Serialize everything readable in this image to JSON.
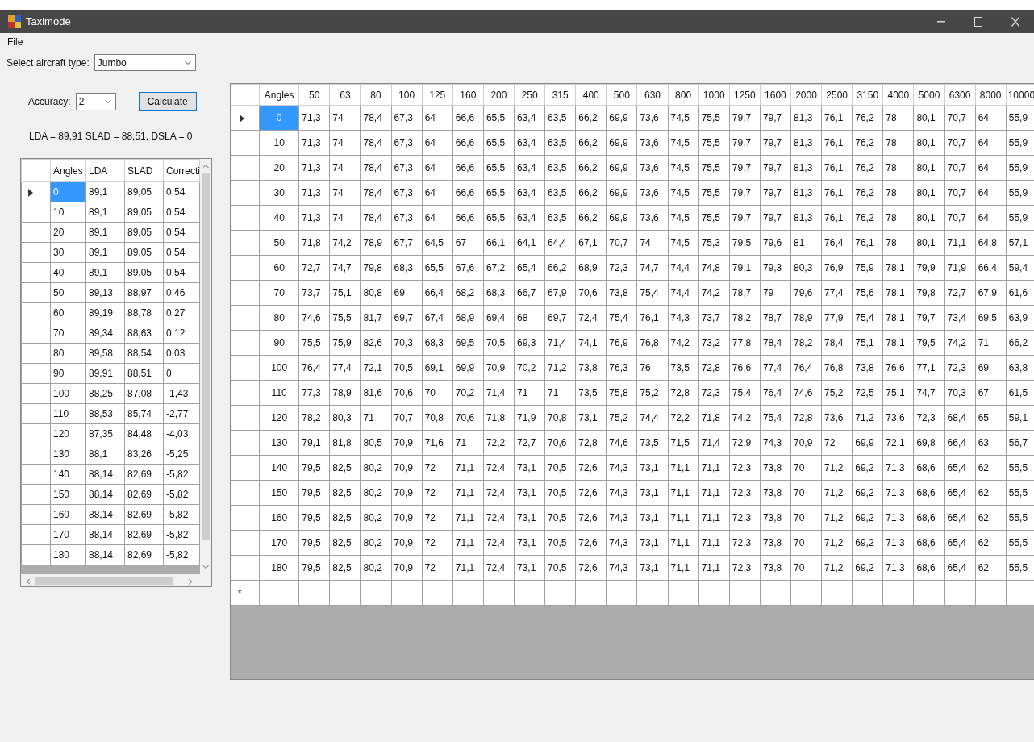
{
  "window": {
    "title": "Taximode"
  },
  "menu": [
    "File"
  ],
  "aircraft": {
    "label": "Select aircraft type:",
    "value": "Jumbo"
  },
  "accuracy": {
    "label": "Accuracy:",
    "value": "2"
  },
  "calculate_button": "Calculate",
  "result": "LDA = 89,91 SLAD = 88,51, DSLA = 0",
  "summary_table": {
    "columns": [
      "Angles",
      "LDA",
      "SLAD",
      "Correcti"
    ],
    "rows": [
      {
        "selected": true,
        "cells": [
          "0",
          "89,1",
          "89,05",
          "0,54"
        ]
      },
      {
        "selected": false,
        "cells": [
          "10",
          "89,1",
          "89,05",
          "0,54"
        ]
      },
      {
        "selected": false,
        "cells": [
          "20",
          "89,1",
          "89,05",
          "0,54"
        ]
      },
      {
        "selected": false,
        "cells": [
          "30",
          "89,1",
          "89,05",
          "0,54"
        ]
      },
      {
        "selected": false,
        "cells": [
          "40",
          "89,1",
          "89,05",
          "0,54"
        ]
      },
      {
        "selected": false,
        "cells": [
          "50",
          "89,13",
          "88,97",
          "0,46"
        ]
      },
      {
        "selected": false,
        "cells": [
          "60",
          "89,19",
          "88,78",
          "0,27"
        ]
      },
      {
        "selected": false,
        "cells": [
          "70",
          "89,34",
          "88,63",
          "0,12"
        ]
      },
      {
        "selected": false,
        "cells": [
          "80",
          "89,58",
          "88,54",
          "0,03"
        ]
      },
      {
        "selected": false,
        "cells": [
          "90",
          "89,91",
          "88,51",
          "0"
        ]
      },
      {
        "selected": false,
        "cells": [
          "100",
          "88,25",
          "87,08",
          "-1,43"
        ]
      },
      {
        "selected": false,
        "cells": [
          "110",
          "88,53",
          "85,74",
          "-2,77"
        ]
      },
      {
        "selected": false,
        "cells": [
          "120",
          "87,35",
          "84,48",
          "-4,03"
        ]
      },
      {
        "selected": false,
        "cells": [
          "130",
          "88,1",
          "83,26",
          "-5,25"
        ]
      },
      {
        "selected": false,
        "cells": [
          "140",
          "88,14",
          "82,69",
          "-5,82"
        ]
      },
      {
        "selected": false,
        "cells": [
          "150",
          "88,14",
          "82,69",
          "-5,82"
        ]
      },
      {
        "selected": false,
        "cells": [
          "160",
          "88,14",
          "82,69",
          "-5,82"
        ]
      },
      {
        "selected": false,
        "cells": [
          "170",
          "88,14",
          "82,69",
          "-5,82"
        ]
      },
      {
        "selected": false,
        "cells": [
          "180",
          "88,14",
          "82,69",
          "-5,82"
        ]
      }
    ]
  },
  "spectrum_table": {
    "columns": [
      "Angles",
      "50",
      "63",
      "80",
      "100",
      "125",
      "160",
      "200",
      "250",
      "315",
      "400",
      "500",
      "630",
      "800",
      "1000",
      "1250",
      "1600",
      "2000",
      "2500",
      "3150",
      "4000",
      "5000",
      "6300",
      "8000",
      "10000"
    ],
    "new_row_marker": "*",
    "rows": [
      {
        "selected": true,
        "cells": [
          "0",
          "71,3",
          "74",
          "78,4",
          "67,3",
          "64",
          "66,6",
          "65,5",
          "63,4",
          "63,5",
          "66,2",
          "69,9",
          "73,6",
          "74,5",
          "75,5",
          "79,7",
          "79,7",
          "81,3",
          "76,1",
          "76,2",
          "78",
          "80,1",
          "70,7",
          "64",
          "55,9"
        ]
      },
      {
        "selected": false,
        "cells": [
          "10",
          "71,3",
          "74",
          "78,4",
          "67,3",
          "64",
          "66,6",
          "65,5",
          "63,4",
          "63,5",
          "66,2",
          "69,9",
          "73,6",
          "74,5",
          "75,5",
          "79,7",
          "79,7",
          "81,3",
          "76,1",
          "76,2",
          "78",
          "80,1",
          "70,7",
          "64",
          "55,9"
        ]
      },
      {
        "selected": false,
        "cells": [
          "20",
          "71,3",
          "74",
          "78,4",
          "67,3",
          "64",
          "66,6",
          "65,5",
          "63,4",
          "63,5",
          "66,2",
          "69,9",
          "73,6",
          "74,5",
          "75,5",
          "79,7",
          "79,7",
          "81,3",
          "76,1",
          "76,2",
          "78",
          "80,1",
          "70,7",
          "64",
          "55,9"
        ]
      },
      {
        "selected": false,
        "cells": [
          "30",
          "71,3",
          "74",
          "78,4",
          "67,3",
          "64",
          "66,6",
          "65,5",
          "63,4",
          "63,5",
          "66,2",
          "69,9",
          "73,6",
          "74,5",
          "75,5",
          "79,7",
          "79,7",
          "81,3",
          "76,1",
          "76,2",
          "78",
          "80,1",
          "70,7",
          "64",
          "55,9"
        ]
      },
      {
        "selected": false,
        "cells": [
          "40",
          "71,3",
          "74",
          "78,4",
          "67,3",
          "64",
          "66,6",
          "65,5",
          "63,4",
          "63,5",
          "66,2",
          "69,9",
          "73,6",
          "74,5",
          "75,5",
          "79,7",
          "79,7",
          "81,3",
          "76,1",
          "76,2",
          "78",
          "80,1",
          "70,7",
          "64",
          "55,9"
        ]
      },
      {
        "selected": false,
        "cells": [
          "50",
          "71,8",
          "74,2",
          "78,9",
          "67,7",
          "64,5",
          "67",
          "66,1",
          "64,1",
          "64,4",
          "67,1",
          "70,7",
          "74",
          "74,5",
          "75,3",
          "79,5",
          "79,6",
          "81",
          "76,4",
          "76,1",
          "78",
          "80,1",
          "71,1",
          "64,8",
          "57,1"
        ]
      },
      {
        "selected": false,
        "cells": [
          "60",
          "72,7",
          "74,7",
          "79,8",
          "68,3",
          "65,5",
          "67,6",
          "67,2",
          "65,4",
          "66,2",
          "68,9",
          "72,3",
          "74,7",
          "74,4",
          "74,8",
          "79,1",
          "79,3",
          "80,3",
          "76,9",
          "75,9",
          "78,1",
          "79,9",
          "71,9",
          "66,4",
          "59,4"
        ]
      },
      {
        "selected": false,
        "cells": [
          "70",
          "73,7",
          "75,1",
          "80,8",
          "69",
          "66,4",
          "68,2",
          "68,3",
          "66,7",
          "67,9",
          "70,6",
          "73,8",
          "75,4",
          "74,4",
          "74,2",
          "78,7",
          "79",
          "79,6",
          "77,4",
          "75,6",
          "78,1",
          "79,8",
          "72,7",
          "67,9",
          "61,6"
        ]
      },
      {
        "selected": false,
        "cells": [
          "80",
          "74,6",
          "75,5",
          "81,7",
          "69,7",
          "67,4",
          "68,9",
          "69,4",
          "68",
          "69,7",
          "72,4",
          "75,4",
          "76,1",
          "74,3",
          "73,7",
          "78,2",
          "78,7",
          "78,9",
          "77,9",
          "75,4",
          "78,1",
          "79,7",
          "73,4",
          "69,5",
          "63,9"
        ]
      },
      {
        "selected": false,
        "cells": [
          "90",
          "75,5",
          "75,9",
          "82,6",
          "70,3",
          "68,3",
          "69,5",
          "70,5",
          "69,3",
          "71,4",
          "74,1",
          "76,9",
          "76,8",
          "74,2",
          "73,2",
          "77,8",
          "78,4",
          "78,2",
          "78,4",
          "75,1",
          "78,1",
          "79,5",
          "74,2",
          "71",
          "66,2"
        ]
      },
      {
        "selected": false,
        "cells": [
          "100",
          "76,4",
          "77,4",
          "72,1",
          "70,5",
          "69,1",
          "69,9",
          "70,9",
          "70,2",
          "71,2",
          "73,8",
          "76,3",
          "76",
          "73,5",
          "72,8",
          "76,6",
          "77,4",
          "76,4",
          "76,8",
          "73,8",
          "76,6",
          "77,1",
          "72,3",
          "69",
          "63,8"
        ]
      },
      {
        "selected": false,
        "cells": [
          "110",
          "77,3",
          "78,9",
          "81,6",
          "70,6",
          "70",
          "70,2",
          "71,4",
          "71",
          "71",
          "73,5",
          "75,8",
          "75,2",
          "72,8",
          "72,3",
          "75,4",
          "76,4",
          "74,6",
          "75,2",
          "72,5",
          "75,1",
          "74,7",
          "70,3",
          "67",
          "61,5"
        ]
      },
      {
        "selected": false,
        "cells": [
          "120",
          "78,2",
          "80,3",
          "71",
          "70,7",
          "70,8",
          "70,6",
          "71,8",
          "71,9",
          "70,8",
          "73,1",
          "75,2",
          "74,4",
          "72,2",
          "71,8",
          "74,2",
          "75,4",
          "72,8",
          "73,6",
          "71,2",
          "73,6",
          "72,3",
          "68,4",
          "65",
          "59,1"
        ]
      },
      {
        "selected": false,
        "cells": [
          "130",
          "79,1",
          "81,8",
          "80,5",
          "70,9",
          "71,6",
          "71",
          "72,2",
          "72,7",
          "70,6",
          "72,8",
          "74,6",
          "73,5",
          "71,5",
          "71,4",
          "72,9",
          "74,3",
          "70,9",
          "72",
          "69,9",
          "72,1",
          "69,8",
          "66,4",
          "63",
          "56,7"
        ]
      },
      {
        "selected": false,
        "cells": [
          "140",
          "79,5",
          "82,5",
          "80,2",
          "70,9",
          "72",
          "71,1",
          "72,4",
          "73,1",
          "70,5",
          "72,6",
          "74,3",
          "73,1",
          "71,1",
          "71,1",
          "72,3",
          "73,8",
          "70",
          "71,2",
          "69,2",
          "71,3",
          "68,6",
          "65,4",
          "62",
          "55,5"
        ]
      },
      {
        "selected": false,
        "cells": [
          "150",
          "79,5",
          "82,5",
          "80,2",
          "70,9",
          "72",
          "71,1",
          "72,4",
          "73,1",
          "70,5",
          "72,6",
          "74,3",
          "73,1",
          "71,1",
          "71,1",
          "72,3",
          "73,8",
          "70",
          "71,2",
          "69,2",
          "71,3",
          "68,6",
          "65,4",
          "62",
          "55,5"
        ]
      },
      {
        "selected": false,
        "cells": [
          "160",
          "79,5",
          "82,5",
          "80,2",
          "70,9",
          "72",
          "71,1",
          "72,4",
          "73,1",
          "70,5",
          "72,6",
          "74,3",
          "73,1",
          "71,1",
          "71,1",
          "72,3",
          "73,8",
          "70",
          "71,2",
          "69,2",
          "71,3",
          "68,6",
          "65,4",
          "62",
          "55,5"
        ]
      },
      {
        "selected": false,
        "cells": [
          "170",
          "79,5",
          "82,5",
          "80,2",
          "70,9",
          "72",
          "71,1",
          "72,4",
          "73,1",
          "70,5",
          "72,6",
          "74,3",
          "73,1",
          "71,1",
          "71,1",
          "72,3",
          "73,8",
          "70",
          "71,2",
          "69,2",
          "71,3",
          "68,6",
          "65,4",
          "62",
          "55,5"
        ]
      },
      {
        "selected": false,
        "cells": [
          "180",
          "79,5",
          "82,5",
          "80,2",
          "70,9",
          "72",
          "71,1",
          "72,4",
          "73,1",
          "70,5",
          "72,6",
          "74,3",
          "73,1",
          "71,1",
          "71,1",
          "72,3",
          "73,8",
          "70",
          "71,2",
          "69,2",
          "71,3",
          "68,6",
          "65,4",
          "62",
          "55,5"
        ]
      }
    ]
  }
}
